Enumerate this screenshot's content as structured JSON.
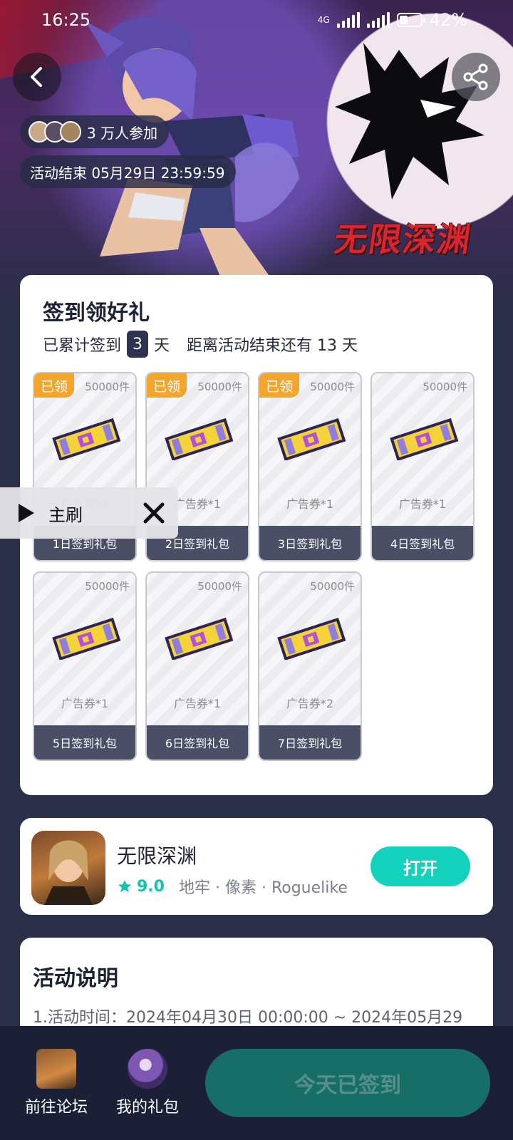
{
  "status_bar": {
    "time": "16:25",
    "network": "4G",
    "battery": "42%",
    "battery_level": 0.42
  },
  "hero": {
    "title_art": "无限深渊",
    "participants": "3 万人参加",
    "end_time": "活动结束 05月29日 23:59:59",
    "icons": {
      "back": "back-arrow-icon",
      "share": "share-icon"
    }
  },
  "checkin": {
    "title": "签到领好礼",
    "progress_prefix": "已累计签到",
    "days_signed": "3",
    "day_unit": "天",
    "remaining_text": "距离活动结束还有 13 天",
    "claimed_label": "已领",
    "gifts": [
      {
        "name": "1日签到礼包",
        "count": "50000件",
        "reward": "广告券*1",
        "claimed": true
      },
      {
        "name": "2日签到礼包",
        "count": "50000件",
        "reward": "广告券*1",
        "claimed": true
      },
      {
        "name": "3日签到礼包",
        "count": "50000件",
        "reward": "广告券*1",
        "claimed": true
      },
      {
        "name": "4日签到礼包",
        "count": "50000件",
        "reward": "广告券*1",
        "claimed": false
      },
      {
        "name": "5日签到礼包",
        "count": "50000件",
        "reward": "广告券*1",
        "claimed": false
      },
      {
        "name": "6日签到礼包",
        "count": "50000件",
        "reward": "广告券*1",
        "claimed": false
      },
      {
        "name": "7日签到礼包",
        "count": "50000件",
        "reward": "广告券*2",
        "claimed": false
      }
    ]
  },
  "float_widget": {
    "label": "主刷",
    "icons": {
      "play": "play-icon",
      "close": "close-icon"
    }
  },
  "game": {
    "name": "无限深渊",
    "rating": "9.0",
    "tags": "地牢 · 像素 · Roguelike",
    "open_label": "打开",
    "accent": "#14d1bd"
  },
  "rules": {
    "title": "活动说明",
    "line1": "1.活动时间：2024年04月30日 00:00:00 ~ 2024年05月29"
  },
  "bottom": {
    "forum_label": "前往论坛",
    "gifts_label": "我的礼包",
    "signed_label": "今天已签到",
    "button_color": "#176e66"
  }
}
